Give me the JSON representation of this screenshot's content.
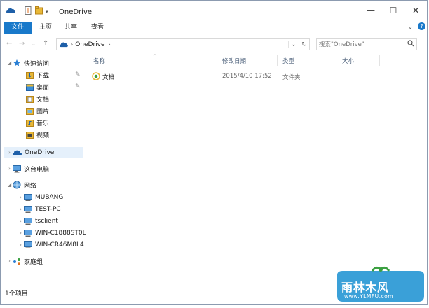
{
  "window": {
    "title": "OneDrive"
  },
  "window_buttons": {
    "minimize": "—",
    "maximize": "☐",
    "close": "✕"
  },
  "ribbon": {
    "tabs": [
      "文件",
      "主页",
      "共享",
      "查看"
    ],
    "expand_icon": "chevron-down-icon",
    "help_icon": "?"
  },
  "address": {
    "crumbs": [
      "OneDrive"
    ],
    "search_placeholder": "搜索\"OneDrive\""
  },
  "nav": {
    "quick_access": "快速访问",
    "quick_items": [
      "下载",
      "桌面",
      "文档",
      "图片",
      "音乐",
      "视频"
    ],
    "onedrive": "OneDrive",
    "this_pc": "这台电脑",
    "network": "网络",
    "network_items": [
      "MUBANG",
      "TEST-PC",
      "tsclient",
      "WIN-C1888ST0L",
      "WIN-CR46M8L4"
    ],
    "homegroup": "家庭组"
  },
  "columns": [
    "名称",
    "修改日期",
    "类型",
    "大小"
  ],
  "files": [
    {
      "name": "文档",
      "modified": "2015/4/10 17:52",
      "type": "文件夹",
      "size": ""
    }
  ],
  "status": {
    "count": "1个项目"
  },
  "watermark": {
    "brand": "雨林木风",
    "url": "www.YLMFU.com"
  },
  "colors": {
    "accent": "#1979ca",
    "selected": "#e5f0fb",
    "folder": "#e8b838",
    "onedrive": "#1e5fa8"
  }
}
